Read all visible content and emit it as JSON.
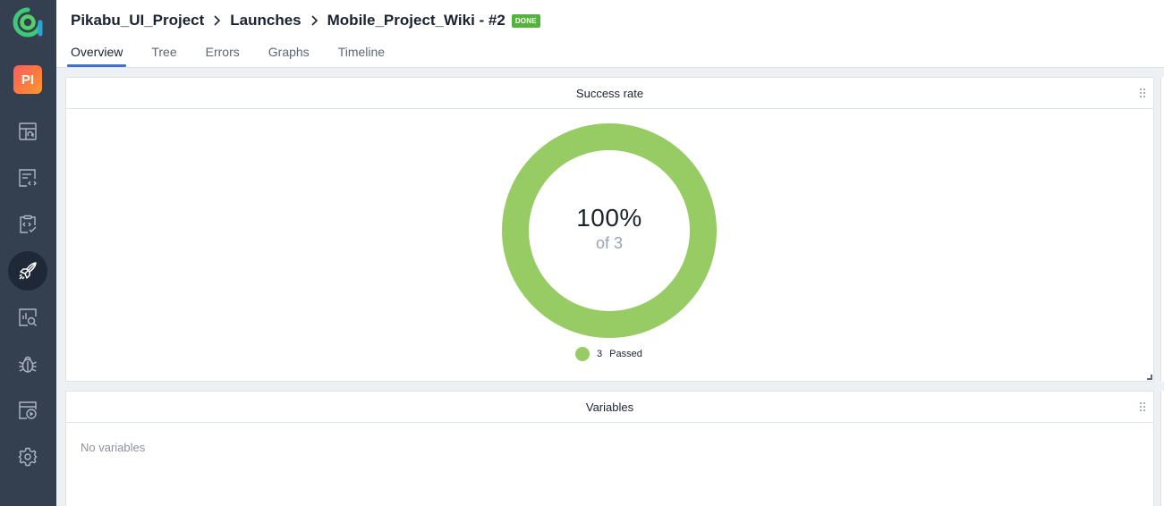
{
  "sidebar": {
    "project_initials": "PI",
    "nav_items": [
      {
        "name": "dashboards-icon"
      },
      {
        "name": "test-cases-icon"
      },
      {
        "name": "test-plans-icon"
      },
      {
        "name": "launches-icon"
      },
      {
        "name": "analytics-icon"
      },
      {
        "name": "defects-icon"
      },
      {
        "name": "jobs-icon"
      },
      {
        "name": "settings-icon"
      }
    ],
    "active": "launches-icon"
  },
  "header": {
    "breadcrumb": [
      "Pikabu_UI_Project",
      "Launches",
      "Mobile_Project_Wiki - #2"
    ],
    "status_badge": "DONE",
    "tabs": [
      {
        "label": "Overview",
        "active": true
      },
      {
        "label": "Tree",
        "active": false
      },
      {
        "label": "Errors",
        "active": false
      },
      {
        "label": "Graphs",
        "active": false
      },
      {
        "label": "Timeline",
        "active": false
      }
    ]
  },
  "widgets": {
    "success_rate": {
      "title": "Success rate",
      "percent_label": "100%",
      "of_label": "of 3",
      "legend_count": "3",
      "legend_label": "Passed"
    },
    "variables": {
      "title": "Variables",
      "empty_text": "No variables"
    }
  },
  "chart_data": {
    "type": "pie",
    "categories": [
      "Passed"
    ],
    "values": [
      3
    ]
  },
  "colors": {
    "sidebar_bg": "#343f4f",
    "accent": "#3d6fd8",
    "passed": "#97cc64",
    "badge": "#52b43a"
  }
}
